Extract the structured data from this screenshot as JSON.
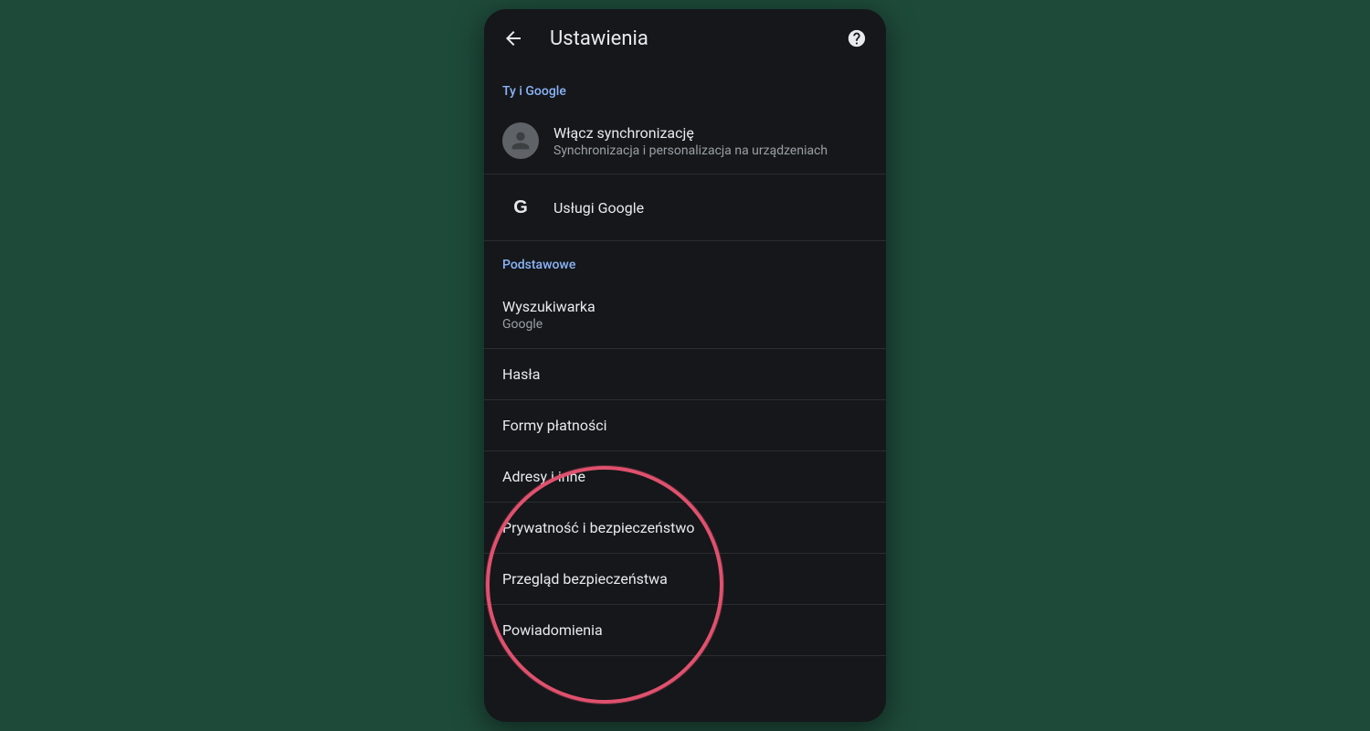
{
  "header": {
    "title": "Ustawienia"
  },
  "sections": {
    "you_and_google": {
      "header": "Ty i Google",
      "sync": {
        "title": "Włącz synchronizację",
        "subtitle": "Synchronizacja i personalizacja na urządzeniach"
      },
      "google_services": {
        "title": "Usługi Google"
      }
    },
    "basics": {
      "header": "Podstawowe",
      "search_engine": {
        "title": "Wyszukiwarka",
        "subtitle": "Google"
      },
      "passwords": {
        "title": "Hasła"
      },
      "payment_methods": {
        "title": "Formy płatności"
      },
      "addresses": {
        "title": "Adresy i inne"
      },
      "privacy": {
        "title": "Prywatność i bezpieczeństwo"
      },
      "safety_check": {
        "title": "Przegląd bezpieczeństwa"
      },
      "notifications": {
        "title": "Powiadomienia"
      }
    }
  }
}
